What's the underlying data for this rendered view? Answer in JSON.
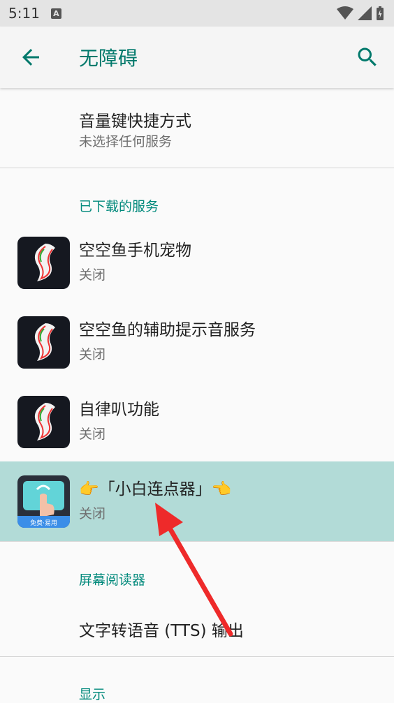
{
  "status_bar": {
    "time": "5:11",
    "notification_glyph": "A"
  },
  "app_bar": {
    "title": "无障碍",
    "back_icon": "arrow-back-icon",
    "search_icon": "search-icon"
  },
  "shortcut": {
    "title": "音量键快捷方式",
    "summary": "未选择任何服务"
  },
  "downloaded": {
    "header": "已下载的服务",
    "items": [
      {
        "title": "空空鱼手机宠物",
        "summary": "关闭"
      },
      {
        "title": "空空鱼的辅助提示音服务",
        "summary": "关闭"
      },
      {
        "title": "自律叭功能",
        "summary": "关闭"
      },
      {
        "title": "👉「小白连点器」👈",
        "summary": "关闭",
        "badge": "免费·易用"
      }
    ]
  },
  "screen_reader": {
    "header": "屏幕阅读器",
    "tts": "文字转语音 (TTS) 输出"
  },
  "display": {
    "header": "显示"
  },
  "colors": {
    "accent": "#00796b",
    "highlight": "#b2dbd7",
    "annotation_arrow": "#ee2a2a"
  }
}
